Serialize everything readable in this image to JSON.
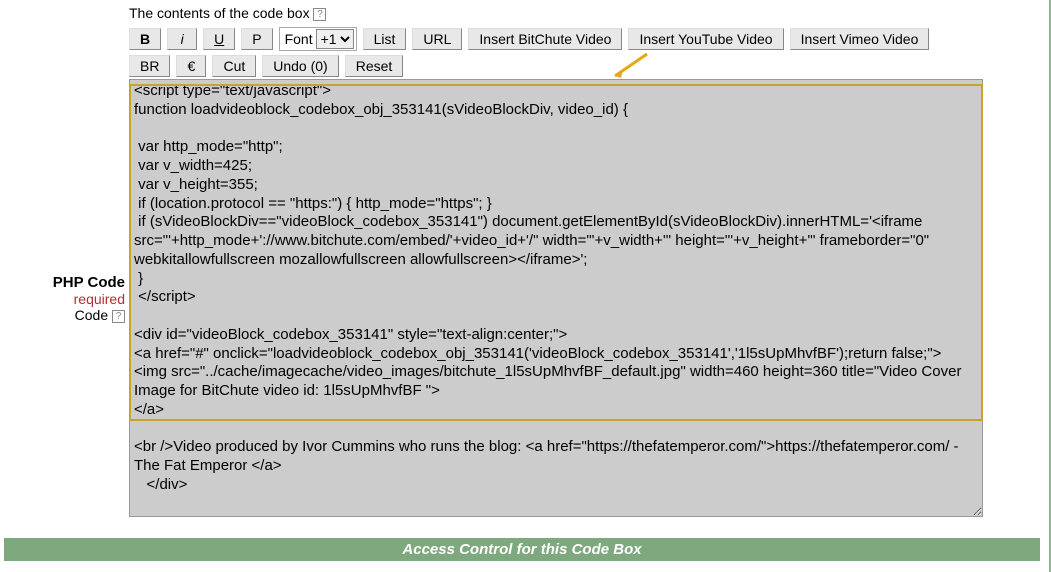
{
  "heading": "The contents of the code box",
  "leftLabels": {
    "main": "PHP Code",
    "required": "required",
    "code": "Code"
  },
  "helpGlyph": "?",
  "toolbar": {
    "row1": {
      "bold": "B",
      "italic": "i",
      "underline": "U",
      "p": "P",
      "fontLabel": "Font",
      "fontValue": "+1",
      "list": "List",
      "url": "URL",
      "bitchute": "Insert BitChute Video",
      "youtube": "Insert YouTube Video",
      "vimeo": "Insert Vimeo Video"
    },
    "row2": {
      "br": "BR",
      "euro": "€",
      "cut": "Cut",
      "undo": "Undo (0)",
      "reset": "Reset"
    }
  },
  "codeContent": "<script type=\"text/javascript\">\nfunction loadvideoblock_codebox_obj_353141(sVideoBlockDiv, video_id) {\n\n var http_mode=\"http\";\n var v_width=425;\n var v_height=355;\n if (location.protocol == \"https:\") { http_mode=\"https\"; }\n if (sVideoBlockDiv==\"videoBlock_codebox_353141\") document.getElementById(sVideoBlockDiv).innerHTML='<iframe src=\"'+http_mode+'://www.bitchute.com/embed/'+video_id+'/\" width=\"'+v_width+'\" height=\"'+v_height+'\" frameborder=\"0\" webkitallowfullscreen mozallowfullscreen allowfullscreen></iframe>';\n }\n </script>\n\n<div id=\"videoBlock_codebox_353141\" style=\"text-align:center;\">\n<a href=\"#\" onclick=\"loadvideoblock_codebox_obj_353141('videoBlock_codebox_353141','1l5sUpMhvfBF');return false;\">\n<img src=\"../cache/imagecache/video_images/bitchute_1l5sUpMhvfBF_default.jpg\" width=460 height=360 title=\"Video Cover Image for BitChute video id: 1l5sUpMhvfBF \">\n</a>\n\n<br />Video produced by Ivor Cummins who runs the blog: <a href=\"https://thefatemperor.com/\">https://thefatemperor.com/ - The Fat Emperor </a>\n   </div>",
  "footer": "Access Control for this Code Box"
}
